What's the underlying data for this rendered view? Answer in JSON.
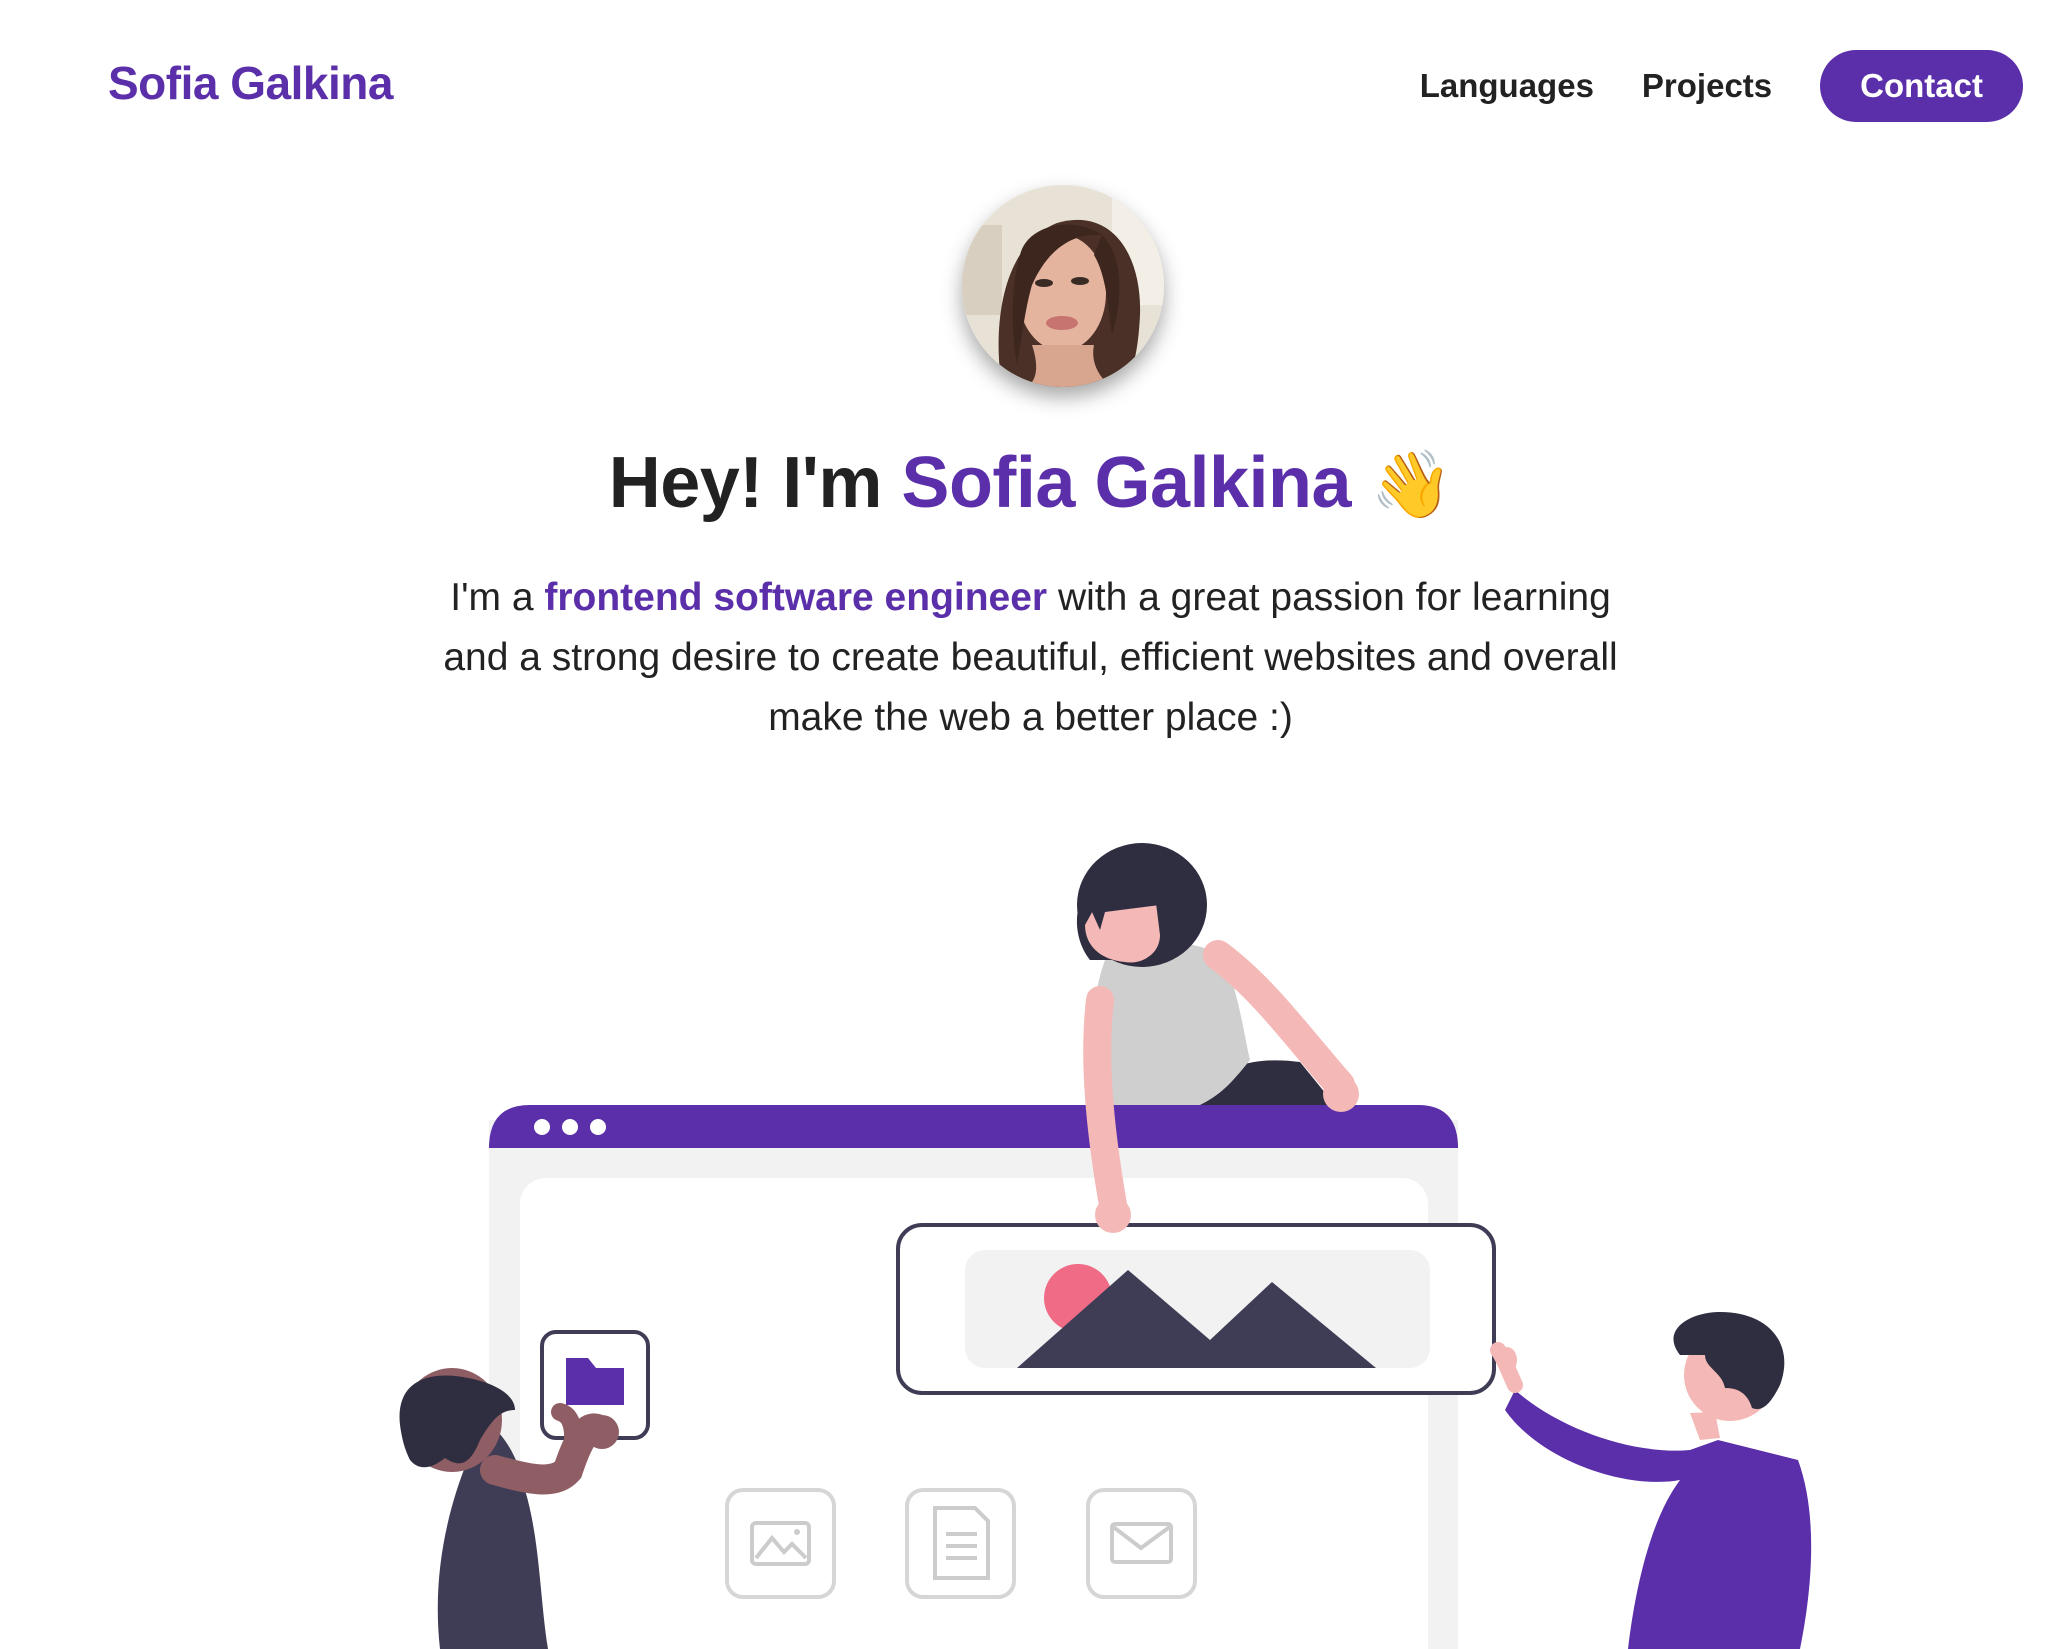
{
  "header": {
    "logo": "Sofia Galkina",
    "nav": {
      "languages": "Languages",
      "projects": "Projects",
      "contact": "Contact"
    }
  },
  "hero": {
    "title_prefix": "Hey! I'm ",
    "title_name": "Sofia Galkina",
    "title_emoji": "👋",
    "intro_prefix": "I'm a ",
    "intro_highlight": "frontend software engineer",
    "intro_line1_rest": " with a great passion for learning",
    "intro_line2": "and a strong desire to create beautiful, efficient websites and overall",
    "intro_line3": "make the web a better place :)"
  },
  "colors": {
    "accent": "#5b2faa",
    "text": "#222222",
    "background": "#ffffff"
  },
  "icons": {
    "avatar": "profile-photo",
    "illustration": "team-building-website-illustration"
  }
}
